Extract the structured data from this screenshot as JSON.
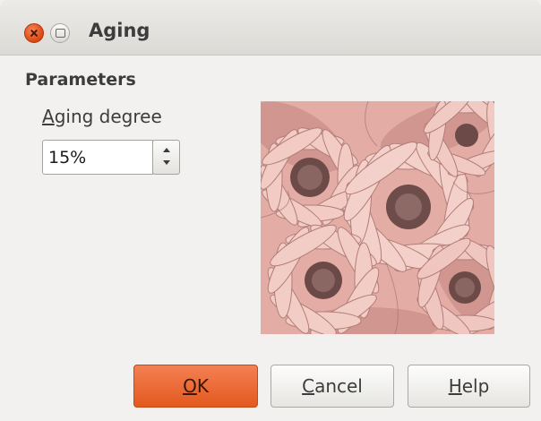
{
  "window": {
    "title": "Aging"
  },
  "parameters": {
    "section_title": "Parameters",
    "aging_degree": {
      "label_mnemonic": "A",
      "label_rest": "ging degree",
      "value": "15%"
    }
  },
  "preview": {
    "image": "pink-tinted-daisy-flowers",
    "tint_color": "#e2aca4",
    "shadow_color": "#5a3a3a"
  },
  "buttons": {
    "ok": {
      "mnemonic": "O",
      "rest": "K"
    },
    "cancel": {
      "mnemonic": "C",
      "rest": "ancel"
    },
    "help": {
      "mnemonic": "H",
      "rest": "elp"
    }
  }
}
